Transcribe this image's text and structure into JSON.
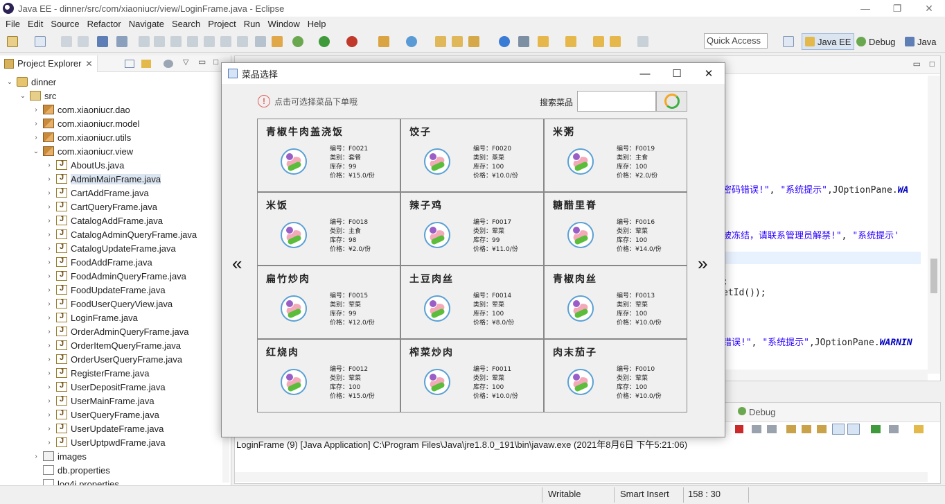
{
  "window": {
    "title": "Java EE - dinner/src/com/xiaoniucr/view/LoginFrame.java - Eclipse"
  },
  "menu": [
    "File",
    "Edit",
    "Source",
    "Refactor",
    "Navigate",
    "Search",
    "Project",
    "Run",
    "Window",
    "Help"
  ],
  "quick_access": "Quick Access",
  "perspectives": {
    "javaee": "Java EE",
    "debug": "Debug",
    "java": "Java"
  },
  "explorer": {
    "tab": "Project Explorer",
    "close": "✕",
    "items": [
      {
        "label": "dinner",
        "depth": 0,
        "tw": "⌄",
        "icon": "project"
      },
      {
        "label": "src",
        "depth": 1,
        "tw": "⌄",
        "icon": "src"
      },
      {
        "label": "com.xiaoniucr.dao",
        "depth": 2,
        "tw": "›",
        "icon": "pkg"
      },
      {
        "label": "com.xiaoniucr.model",
        "depth": 2,
        "tw": "›",
        "icon": "pkg"
      },
      {
        "label": "com.xiaoniucr.utils",
        "depth": 2,
        "tw": "›",
        "icon": "pkg"
      },
      {
        "label": "com.xiaoniucr.view",
        "depth": 2,
        "tw": "⌄",
        "icon": "pkg"
      },
      {
        "label": "AboutUs.java",
        "depth": 3,
        "tw": "›",
        "icon": "java"
      },
      {
        "label": "AdminMainFrame.java",
        "depth": 3,
        "tw": "›",
        "icon": "java",
        "selected": true
      },
      {
        "label": "CartAddFrame.java",
        "depth": 3,
        "tw": "›",
        "icon": "java"
      },
      {
        "label": "CartQueryFrame.java",
        "depth": 3,
        "tw": "›",
        "icon": "java"
      },
      {
        "label": "CatalogAddFrame.java",
        "depth": 3,
        "tw": "›",
        "icon": "java"
      },
      {
        "label": "CatalogAdminQueryFrame.java",
        "depth": 3,
        "tw": "›",
        "icon": "java"
      },
      {
        "label": "CatalogUpdateFrame.java",
        "depth": 3,
        "tw": "›",
        "icon": "java"
      },
      {
        "label": "FoodAddFrame.java",
        "depth": 3,
        "tw": "›",
        "icon": "java"
      },
      {
        "label": "FoodAdminQueryFrame.java",
        "depth": 3,
        "tw": "›",
        "icon": "java"
      },
      {
        "label": "FoodUpdateFrame.java",
        "depth": 3,
        "tw": "›",
        "icon": "java"
      },
      {
        "label": "FoodUserQueryView.java",
        "depth": 3,
        "tw": "›",
        "icon": "java"
      },
      {
        "label": "LoginFrame.java",
        "depth": 3,
        "tw": "›",
        "icon": "java"
      },
      {
        "label": "OrderAdminQueryFrame.java",
        "depth": 3,
        "tw": "›",
        "icon": "java"
      },
      {
        "label": "OrderItemQueryFrame.java",
        "depth": 3,
        "tw": "›",
        "icon": "java"
      },
      {
        "label": "OrderUserQueryFrame.java",
        "depth": 3,
        "tw": "›",
        "icon": "java"
      },
      {
        "label": "RegisterFrame.java",
        "depth": 3,
        "tw": "›",
        "icon": "java"
      },
      {
        "label": "UserDepositFrame.java",
        "depth": 3,
        "tw": "›",
        "icon": "java"
      },
      {
        "label": "UserMainFrame.java",
        "depth": 3,
        "tw": "›",
        "icon": "java"
      },
      {
        "label": "UserQueryFrame.java",
        "depth": 3,
        "tw": "›",
        "icon": "java"
      },
      {
        "label": "UserUpdateFrame.java",
        "depth": 3,
        "tw": "›",
        "icon": "java"
      },
      {
        "label": "UserUptpwdFrame.java",
        "depth": 3,
        "tw": "›",
        "icon": "java"
      },
      {
        "label": "images",
        "depth": 2,
        "tw": "›",
        "icon": "folder"
      },
      {
        "label": "db.properties",
        "depth": 2,
        "tw": "",
        "icon": "file"
      },
      {
        "label": "log4j.properties",
        "depth": 2,
        "tw": "",
        "icon": "file"
      }
    ]
  },
  "editor": {
    "lines": [
      {
        "parts": [
          {
            "t": "密码错误!\"",
            "c": "str"
          },
          {
            "t": ", ",
            "c": ""
          },
          {
            "t": "\"系统提示\"",
            "c": "str"
          },
          {
            "t": ",JOptionPane.",
            "c": ""
          },
          {
            "t": "WA",
            "c": "const"
          }
        ]
      },
      {
        "parts": [
          {
            "t": "被冻结，请联系管理员解禁!\"",
            "c": "str"
          },
          {
            "t": ", ",
            "c": ""
          },
          {
            "t": "\"系统提示'",
            "c": "str"
          }
        ]
      },
      {
        "parts": [
          {
            "t": ";",
            "c": ""
          }
        ]
      },
      {
        "parts": [
          {
            "t": "etId());",
            "c": ""
          }
        ]
      },
      {
        "parts": [
          {
            "t": "错误!\"",
            "c": "str"
          },
          {
            "t": ", ",
            "c": ""
          },
          {
            "t": "\"系统提示\"",
            "c": "str"
          },
          {
            "t": ",JOptionPane.",
            "c": ""
          },
          {
            "t": "WARNIN",
            "c": "const"
          }
        ]
      }
    ]
  },
  "console": {
    "debug_tab": "Debug",
    "description": "LoginFrame (9) [Java Application] C:\\Program Files\\Java\\jre1.8.0_191\\bin\\javaw.exe (2021年8月6日 下午5:21:06)"
  },
  "status": {
    "writable": "Writable",
    "insert": "Smart Insert",
    "position": "158 : 30"
  },
  "dialog": {
    "title": "菜品选择",
    "hint": "点击可选择菜品下单哦",
    "search_label": "搜索菜品",
    "search_value": "",
    "prev": "«",
    "next": "»",
    "foods": [
      {
        "name": "青椒牛肉盖浇饭",
        "code": "编号：F0021",
        "type": "类别：套餐",
        "stock": "库存：99",
        "price": "价格：¥15.0/份"
      },
      {
        "name": "饺子",
        "code": "编号：F0020",
        "type": "类别：蒸菜",
        "stock": "库存：100",
        "price": "价格：¥10.0/份"
      },
      {
        "name": "米粥",
        "code": "编号：F0019",
        "type": "类别：主食",
        "stock": "库存：100",
        "price": "价格：¥2.0/份"
      },
      {
        "name": "米饭",
        "code": "编号：F0018",
        "type": "类别：主食",
        "stock": "库存：98",
        "price": "价格：¥2.0/份"
      },
      {
        "name": "辣子鸡",
        "code": "编号：F0017",
        "type": "类别：荤菜",
        "stock": "库存：99",
        "price": "价格：¥11.0/份"
      },
      {
        "name": "糖醋里脊",
        "code": "编号：F0016",
        "type": "类别：荤菜",
        "stock": "库存：100",
        "price": "价格：¥14.0/份"
      },
      {
        "name": "扁竹炒肉",
        "code": "编号：F0015",
        "type": "类别：荤菜",
        "stock": "库存：99",
        "price": "价格：¥12.0/份"
      },
      {
        "name": "土豆肉丝",
        "code": "编号：F0014",
        "type": "类别：荤菜",
        "stock": "库存：100",
        "price": "价格：¥8.0/份"
      },
      {
        "name": "青椒肉丝",
        "code": "编号：F0013",
        "type": "类别：荤菜",
        "stock": "库存：100",
        "price": "价格：¥10.0/份"
      },
      {
        "name": "红烧肉",
        "code": "编号：F0012",
        "type": "类别：荤菜",
        "stock": "库存：100",
        "price": "价格：¥15.0/份"
      },
      {
        "name": "榨菜炒肉",
        "code": "编号：F0011",
        "type": "类别：荤菜",
        "stock": "库存：100",
        "price": "价格：¥10.0/份"
      },
      {
        "name": "肉末茄子",
        "code": "编号：F0010",
        "type": "类别：荤菜",
        "stock": "库存：100",
        "price": "价格：¥10.0/份"
      }
    ]
  }
}
